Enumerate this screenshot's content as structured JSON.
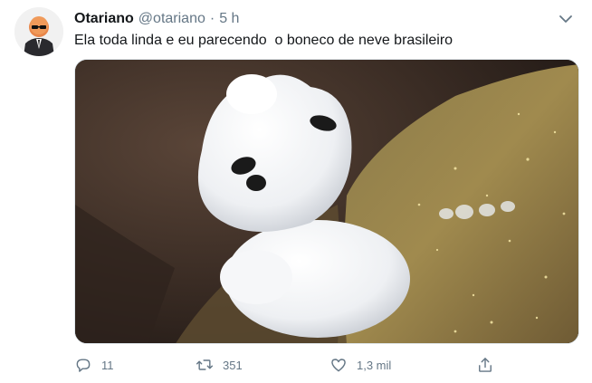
{
  "tweet": {
    "author": {
      "display_name": "Otariano",
      "handle": "@otariano",
      "separator": "·",
      "time": "5 h"
    },
    "text": "Ela toda linda e eu parecendo  o boneco de neve brasileiro",
    "media": {
      "icon": "snowman-photo"
    },
    "actions": {
      "replies": "11",
      "retweets": "351",
      "likes": "1,3 mil"
    }
  },
  "colors": {
    "text_primary": "#14171a",
    "text_secondary": "#657786",
    "border": "#e1e8ed"
  }
}
